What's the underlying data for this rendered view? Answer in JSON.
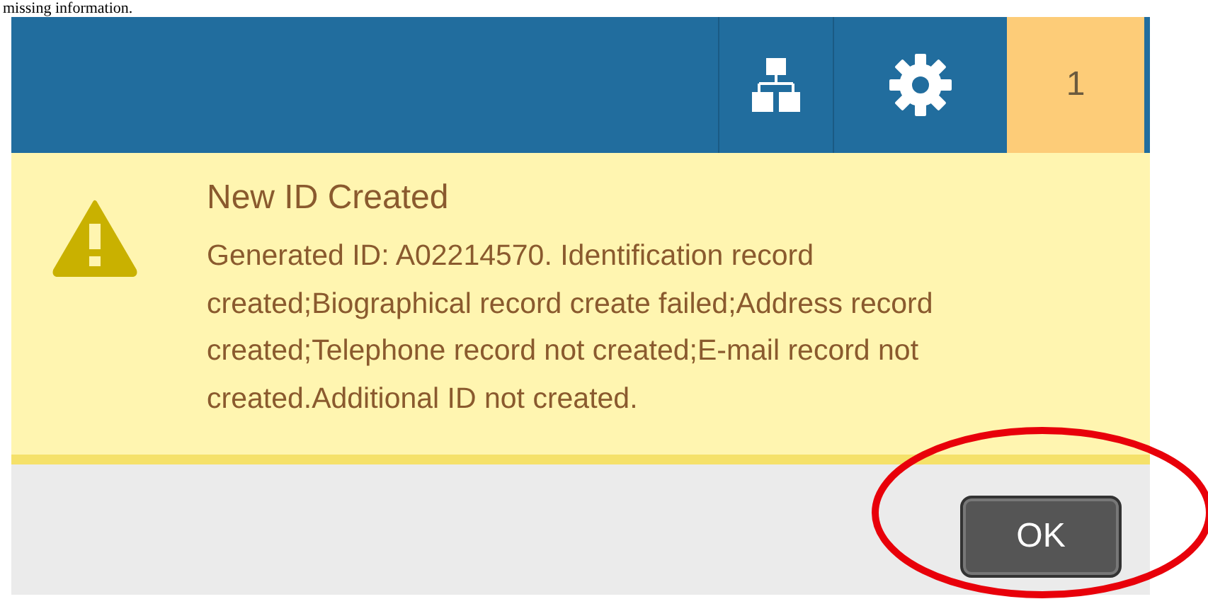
{
  "document_text": "missing information.",
  "header": {
    "badge": "1"
  },
  "alert": {
    "title": "New ID Created",
    "message": "Generated ID: A02214570. Identification record created;Biographical record create failed;Address record created;Telephone record not created;E-mail record not created.Additional ID not created."
  },
  "buttons": [
    {
      "label": "OK",
      "kind": "primary"
    }
  ]
}
